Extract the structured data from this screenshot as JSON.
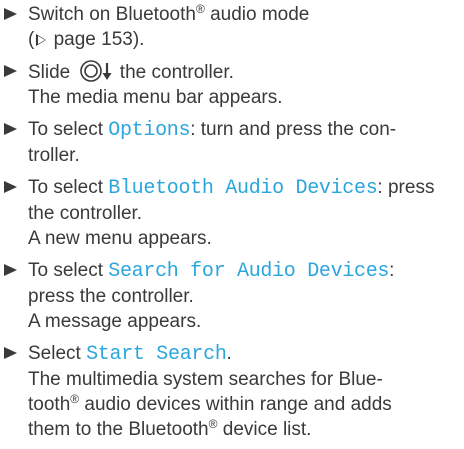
{
  "steps": [
    {
      "line1_text": "Switch on Bluetooth",
      "line1_sup": "®",
      "line1_after": " audio mode",
      "line2_open": "(",
      "line2_ref": "page 153).",
      "icon": "triangle-right-outline-icon"
    },
    {
      "line1_before": "Slide ",
      "line1_after": " the controller.",
      "line2": "The media menu bar appears.",
      "icon": "controller-slide-down-icon"
    },
    {
      "line1_before": "To select ",
      "line1_code": "Options",
      "line1_after": ": turn and press the con-",
      "line2": "troller."
    },
    {
      "line1_before": "To select ",
      "line1_code": "Bluetooth Audio Devices",
      "line1_after": ": press",
      "line2": "the controller.",
      "line3": "A new menu appears."
    },
    {
      "line1_before": "To select ",
      "line1_code": "Search for Audio Devices",
      "line1_after": ":",
      "line2": "press the controller.",
      "line3": "A message appears."
    },
    {
      "line1_before": "Select ",
      "line1_code": "Start Search",
      "line1_after": ".",
      "line2": "The multimedia system searches for Blue-",
      "line3_before": "tooth",
      "line3_sup": "®",
      "line3_after": " audio devices within range and adds",
      "line4_before": "them to the Bluetooth",
      "line4_sup": "®",
      "line4_after": " device list."
    }
  ],
  "colors": {
    "text": "#3a3a3a",
    "accent": "#2aa6dc"
  }
}
